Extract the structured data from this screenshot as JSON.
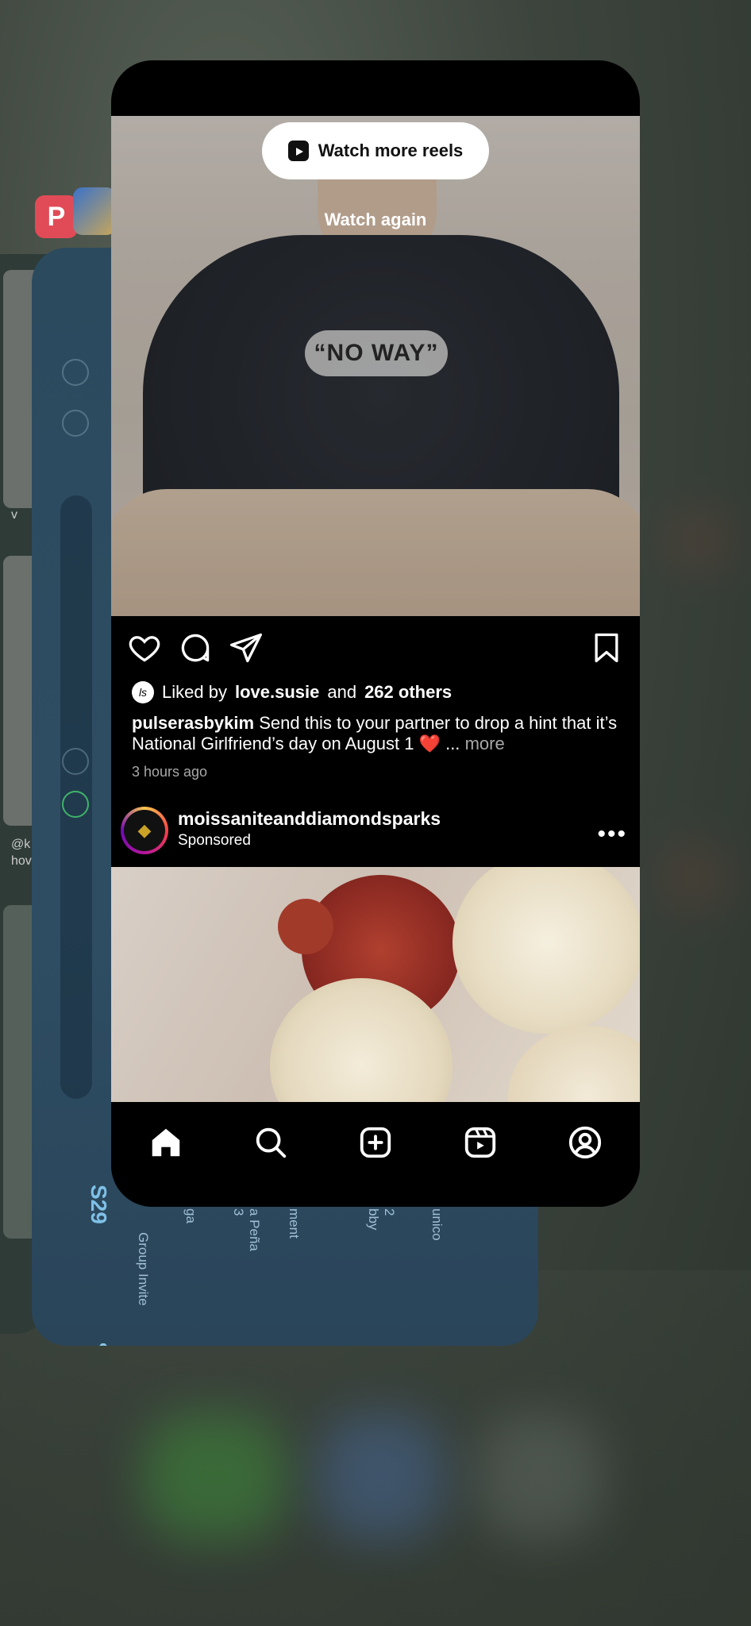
{
  "background_apps": {
    "pinterest_icon": "P",
    "game_labels": [
      "S29",
      "Group Invite",
      "ga",
      "a Peña",
      "ment",
      "bby",
      "unico",
      "2",
      "3",
      "v",
      "@k",
      "hov"
    ]
  },
  "reel": {
    "watch_more_label": "Watch more reels",
    "watch_again_label": "Watch again",
    "caption_overlay": "“NO WAY”"
  },
  "post1": {
    "liked_by_prefix": "Liked by",
    "liked_by_user": "love.susie",
    "liked_by_and": "and",
    "liked_by_others": "262 others",
    "avatar_letter": "ls",
    "caption_user": "pulserasbykim",
    "caption_text": "Send this to your partner to drop a hint that it’s National Girlfriend’s day on August 1 ❤️ ...",
    "caption_more": "more",
    "timestamp": "3 hours ago"
  },
  "post2": {
    "username": "moissaniteanddiamondsparks",
    "subtitle": "Sponsored",
    "menu": "•••"
  },
  "tabbar": {
    "items": [
      "home",
      "search",
      "create",
      "reels",
      "profile"
    ]
  },
  "colors": {
    "card_bg": "#000000",
    "text": "#ffffff",
    "muted": "#a8a8a8",
    "heart": "#e0263b"
  }
}
